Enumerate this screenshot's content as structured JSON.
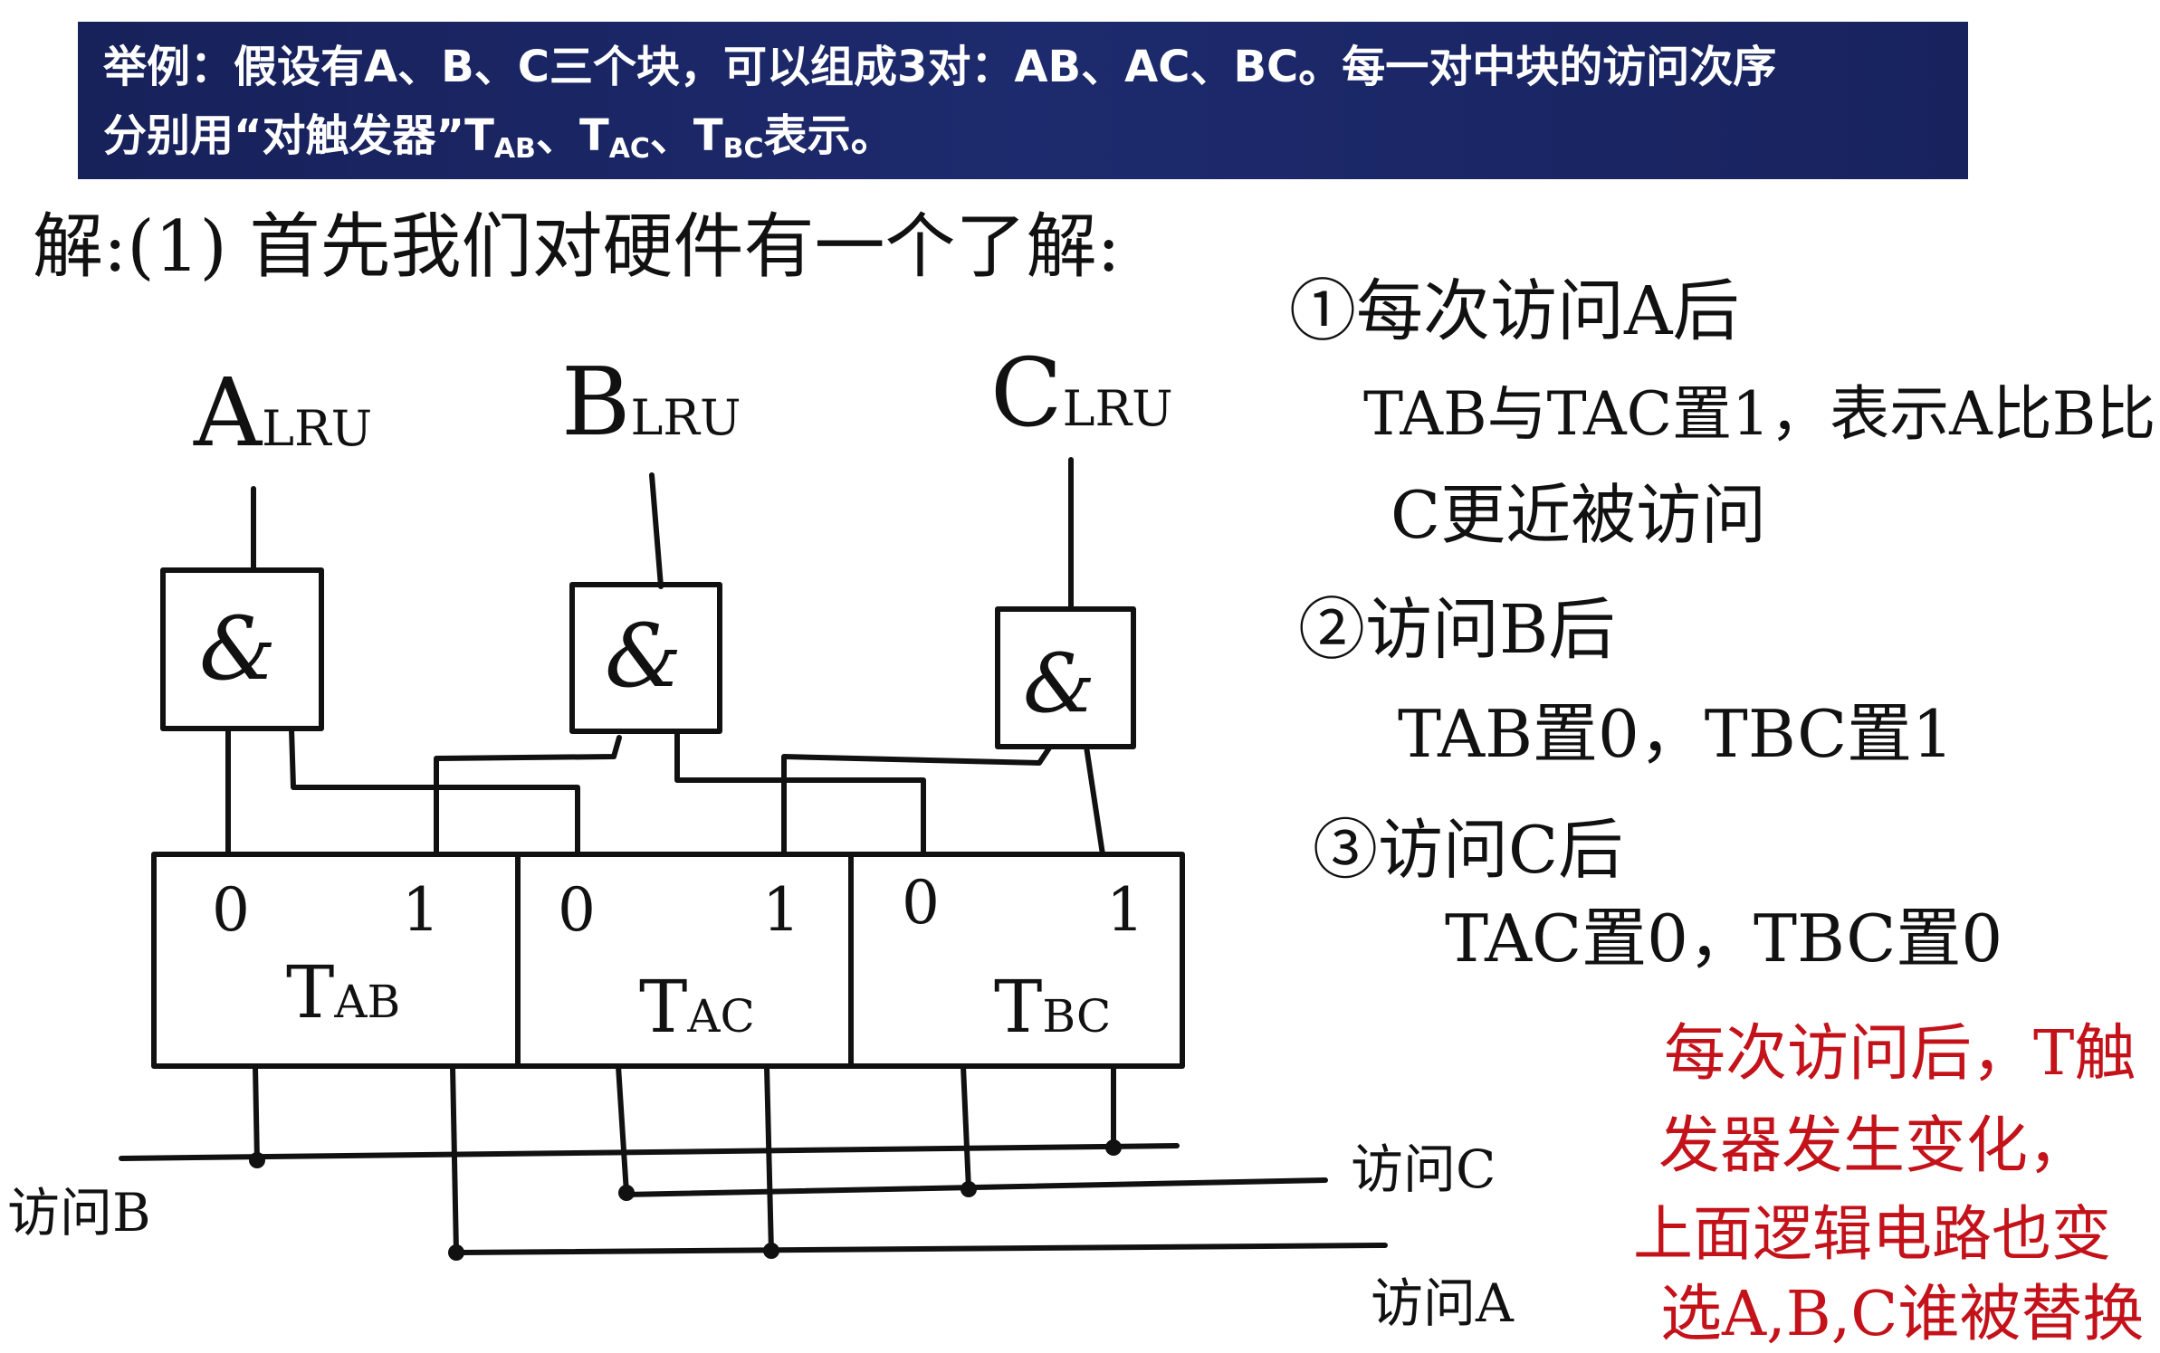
{
  "banner": {
    "line1": "举例：假设有A、B、C三个块，可以组成3对：AB、AC、BC。每一对中块的访问次序",
    "line2_pre": "分别用“对触发器”T",
    "sub_ab": "AB",
    "sep1": "、T",
    "sub_ac": "AC",
    "sep2": "、T",
    "sub_bc": "BC",
    "line2_post": "表示。"
  },
  "solution_heading": "解:(1) 首先我们对硬件有一个了解:",
  "diagram": {
    "inputs": [
      {
        "main": "A",
        "sub": "LRU"
      },
      {
        "main": "B",
        "sub": "LRU"
      },
      {
        "main": "C",
        "sub": "LRU"
      }
    ],
    "gate_symbol": "&",
    "flipflops": [
      {
        "zero": "0",
        "one": "1",
        "label": "T",
        "sub": "AB"
      },
      {
        "zero": "0",
        "one": "1",
        "label": "T",
        "sub": "AC"
      },
      {
        "zero": "0",
        "one": "1",
        "label": "T",
        "sub": "BC"
      }
    ],
    "bus_labels": {
      "access_b": "访问B",
      "access_c": "访问C",
      "access_a": "访问A"
    }
  },
  "notes": {
    "n1_title": "①每次访问A后",
    "n1_line1": "TAB与TAC置1，表示A比B比",
    "n1_line2": "C更近被访问",
    "n2_title": "②访问B后",
    "n2_line1": "TAB置0，TBC置1",
    "n3_title": "③访问C后",
    "n3_line1": "TAC置0，TBC置0"
  },
  "red_note": {
    "line1": "每次访问后，T触",
    "line2": "发器发生变化，",
    "line3": "上面逻辑电路也变",
    "line4": "选A,B,C谁被替换"
  },
  "colors": {
    "banner_bg": "#1b2766",
    "ink": "#111111",
    "red_ink": "#c4121a"
  }
}
